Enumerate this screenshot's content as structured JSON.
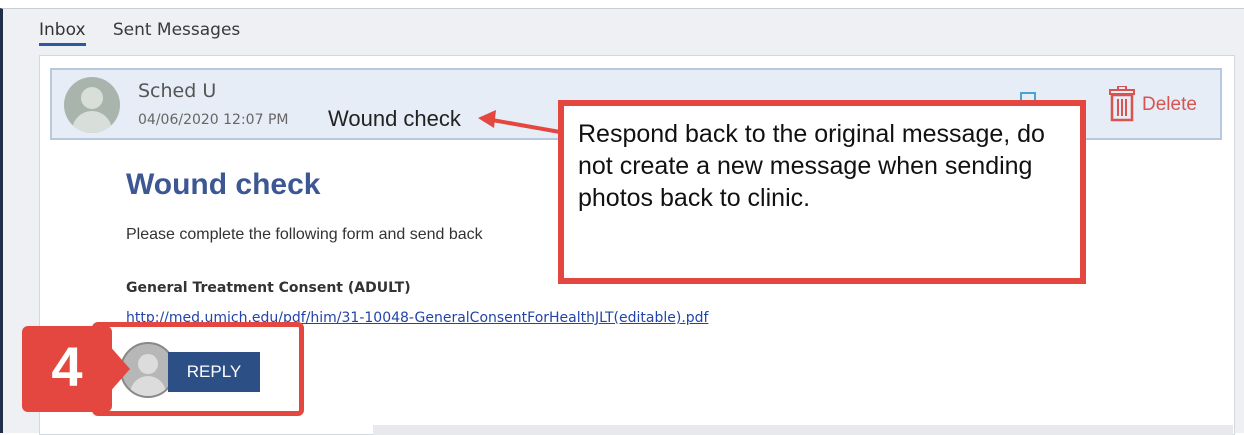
{
  "tabs": {
    "inbox": "Inbox",
    "sent": "Sent Messages"
  },
  "message": {
    "sender": "Sched U",
    "datetime": "04/06/2020 12:07 PM",
    "subject": "Wound check",
    "delete_label": "Delete"
  },
  "body": {
    "title": "Wound check",
    "text": "Please complete the following form and send back",
    "consent_label": "General Treatment Consent (ADULT)",
    "consent_link": "http://med.umich.edu/pdf/him/31-10048-GeneralConsentForHealthJLT(editable).pdf"
  },
  "reply": {
    "label": "REPLY"
  },
  "annotation": {
    "step": "4",
    "callout": "Respond back to the original message, do not create a new message when sending photos back to clinic."
  },
  "colors": {
    "accent": "#2c4f86",
    "annotation": "#e4473f",
    "delete": "#d9534f",
    "title": "#3d5795"
  }
}
